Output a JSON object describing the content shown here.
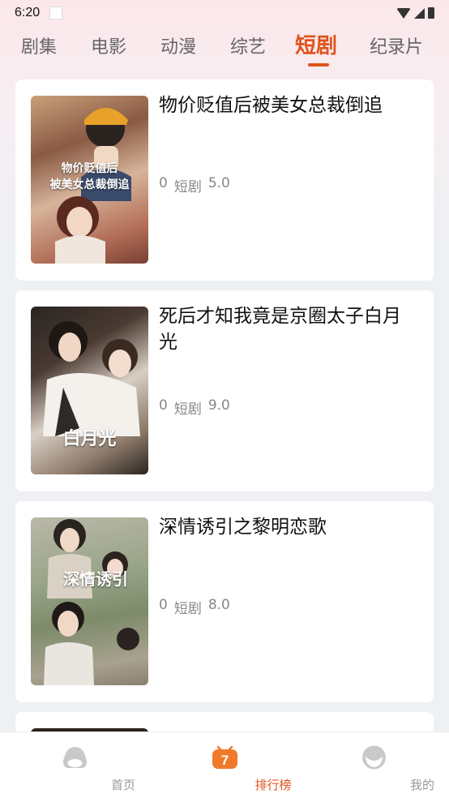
{
  "status": {
    "time": "6:20"
  },
  "tabs": [
    {
      "label": "剧集"
    },
    {
      "label": "电影"
    },
    {
      "label": "动漫"
    },
    {
      "label": "综艺"
    },
    {
      "label": "短剧"
    },
    {
      "label": "纪录片"
    }
  ],
  "active_tab": "短剧",
  "items": [
    {
      "title": "物价贬值后被美女总裁倒追",
      "count": "0",
      "category": "短剧",
      "score": "5.0",
      "poster_text": "物价贬值后\n被美女总裁倒追"
    },
    {
      "title": "死后才知我竟是京圈太子白月光",
      "count": "0",
      "category": "短剧",
      "score": "9.0",
      "poster_text": "白月光"
    },
    {
      "title": "深情诱引之黎明恋歌",
      "count": "0",
      "category": "短剧",
      "score": "8.0",
      "poster_text": "深情诱引"
    }
  ],
  "bottom_nav": [
    {
      "label": "首页",
      "icon": "home-icon"
    },
    {
      "label": "排行榜",
      "icon": "ranking-icon",
      "badge": "7"
    },
    {
      "label": "我的",
      "icon": "profile-icon"
    }
  ],
  "colors": {
    "accent": "#e0531c",
    "card_bg": "#ffffff",
    "page_bg": "#eef0f4"
  }
}
